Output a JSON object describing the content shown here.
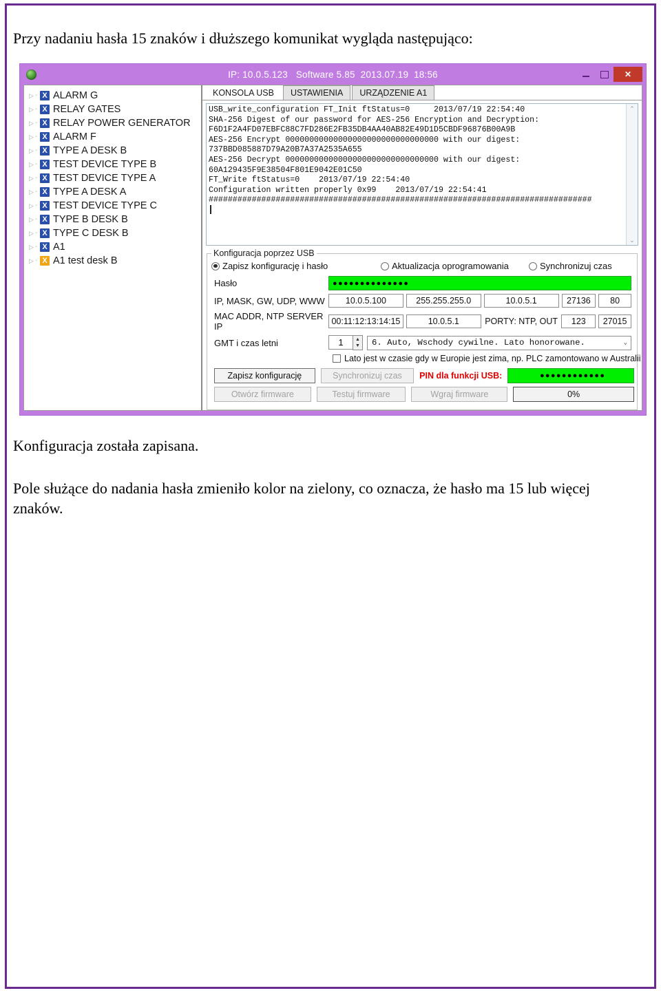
{
  "document": {
    "intro": "Przy nadaniu hasła 15 znaków i dłuższego komunikat wygląda następująco:",
    "after_1": "Konfiguracja została zapisana.",
    "after_2": "Pole służące do nadania hasła zmieniło kolor na zielony, co oznacza, że hasło ma 15 lub więcej znaków."
  },
  "colors": {
    "page_border": "#6b2a8f",
    "window_chrome": "#c07ce0",
    "close_button": "#c0392b",
    "green_field": "#00ee00",
    "tree_icon_blue": "#2a4fa8",
    "tree_icon_orange": "#f0a515",
    "pin_label_red": "#e00000"
  },
  "window": {
    "title": "IP: 10.0.5.123   Software 5.85  2013.07.19  18:56",
    "logo_icon": "globe-icon",
    "controls": {
      "minimize": "−",
      "maximize": "▢",
      "close": "✕"
    }
  },
  "tree": {
    "items": [
      {
        "label": "ALARM G",
        "icon_color": "blue"
      },
      {
        "label": "RELAY GATES",
        "icon_color": "blue"
      },
      {
        "label": "RELAY POWER GENERATOR",
        "icon_color": "blue"
      },
      {
        "label": "ALARM F",
        "icon_color": "blue"
      },
      {
        "label": "TYPE A DESK B",
        "icon_color": "blue"
      },
      {
        "label": "TEST DEVICE TYPE B",
        "icon_color": "blue"
      },
      {
        "label": "TEST DEVICE TYPE A",
        "icon_color": "blue"
      },
      {
        "label": "TYPE A DESK A",
        "icon_color": "blue"
      },
      {
        "label": "TEST DEVICE TYPE C",
        "icon_color": "blue"
      },
      {
        "label": "TYPE B DESK B",
        "icon_color": "blue"
      },
      {
        "label": "TYPE C DESK B",
        "icon_color": "blue"
      },
      {
        "label": "A1",
        "icon_color": "blue"
      },
      {
        "label": "A1 test desk B",
        "icon_color": "orange"
      }
    ],
    "expander_glyph": "▷",
    "icon_glyph": "X"
  },
  "tabs": [
    {
      "label": "KONSOLA USB",
      "active": true
    },
    {
      "label": "USTAWIENIA",
      "active": false
    },
    {
      "label": "URZĄDZENIE A1",
      "active": false
    }
  ],
  "console": {
    "text": "USB_write_configuration FT_Init ftStatus=0     2013/07/19 22:54:40\nSHA-256 Digest of our password for AES-256 Encryption and Decryption:\nF6D1F2A4FD07EBFC88C7FD286E2FB35DB4AA40AB82E49D1D5CBDF96876B00A9B\nAES-256 Encrypt 00000000000000000000000000000000 with our digest:\n737BBD085887D79A20B7A37A2535A655\nAES-256 Decrypt 00000000000000000000000000000000 with our digest:\n60A129435F9E38504F801E9042E01C50\nFT_Write ftStatus=0    2013/07/19 22:54:40\nConfiguration written properly 0x99    2013/07/19 22:54:41\n################################################################################",
    "scroll_up": "⌃",
    "scroll_down": "⌄"
  },
  "config": {
    "legend": "Konfiguracja poprzez USB",
    "radios": [
      {
        "label": "Zapisz konfigurację i hasło",
        "selected": true
      },
      {
        "label": "Aktualizacja oprogramowania",
        "selected": false
      },
      {
        "label": "Synchronizuj czas",
        "selected": false
      }
    ],
    "password": {
      "label": "Hasło",
      "value": "●●●●●●●●●●●●●●"
    },
    "network": {
      "label": "IP, MASK, GW, UDP, WWW",
      "ip": "10.0.5.100",
      "mask": "255.255.255.0",
      "gateway": "10.0.5.1",
      "udp": "27136",
      "www": "80"
    },
    "mac": {
      "label": "MAC ADDR, NTP SERVER IP",
      "mac_addr": "00:11:12:13:14:15",
      "ntp_server_ip": "10.0.5.1",
      "ports_label": "PORTY: NTP, OUT",
      "ntp_port": "123",
      "out_port": "27015"
    },
    "gmt": {
      "label": "GMT i czas letni",
      "offset": "1",
      "dst_mode": "6. Auto, Wschody cywilne. Lato honorowane.",
      "spin_up": "▲",
      "spin_down": "▼",
      "combo_arrow": "⌄"
    },
    "southern_checkbox": {
      "label": "Lato jest w czasie gdy w Europie jest zima, np. PLC zamontowano w Australii",
      "checked": false
    },
    "buttons_row1": [
      {
        "label": "Zapisz konfigurację",
        "enabled": true
      },
      {
        "label": "Synchronizuj czas",
        "enabled": false
      }
    ],
    "pin": {
      "label": "PIN dla funkcji USB:",
      "value": "●●●●●●●●●●●●"
    },
    "buttons_row2": [
      {
        "label": "Otwórz firmware",
        "enabled": false
      },
      {
        "label": "Testuj firmware",
        "enabled": false
      },
      {
        "label": "Wgraj firmware",
        "enabled": false
      }
    ],
    "progress": "0%"
  }
}
